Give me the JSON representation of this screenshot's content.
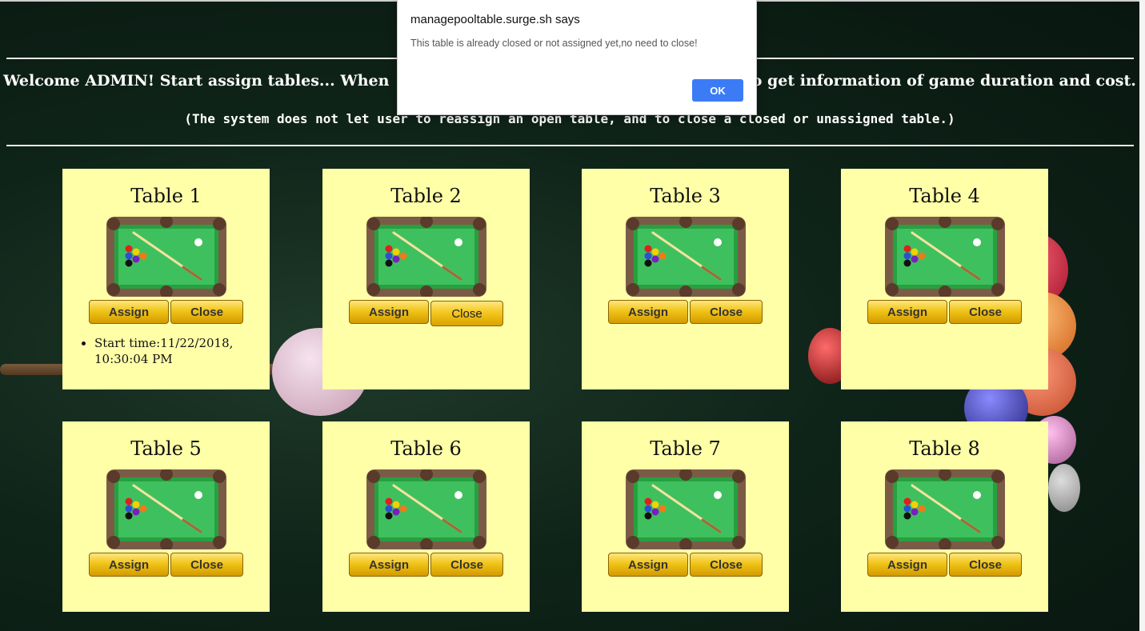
{
  "dialog": {
    "title": "managepooltable.surge.sh says",
    "message": "This table is already closed or not assigned yet,no need to close!",
    "ok_label": "OK",
    "button_color": "#3b7cf6"
  },
  "header": {
    "welcome": "Welcome ADMIN! Start assign tables... When",
    "welcome_tail": "o get information of game duration and cost.",
    "note": "(The system does not let user to reassign an open table, and to close a closed or unassigned table.)"
  },
  "colors": {
    "card_background": "#ffffa8",
    "button_gold": "#f0c418",
    "page_background": "#0f2419"
  },
  "tables": [
    {
      "title": "Table 1",
      "assign_label": "Assign",
      "close_label": "Close",
      "image_icon": "pool-table-icon",
      "start_time": "Start time:11/22/2018, 10:30:04 PM"
    },
    {
      "title": "Table 2",
      "assign_label": "Assign",
      "close_label": "Close",
      "image_icon": "pool-table-icon"
    },
    {
      "title": "Table 3",
      "assign_label": "Assign",
      "close_label": "Close",
      "image_icon": "pool-table-icon"
    },
    {
      "title": "Table 4",
      "assign_label": "Assign",
      "close_label": "Close",
      "image_icon": "pool-table-icon"
    },
    {
      "title": "Table 5",
      "assign_label": "Assign",
      "close_label": "Close",
      "image_icon": "pool-table-icon"
    },
    {
      "title": "Table 6",
      "assign_label": "Assign",
      "close_label": "Close",
      "image_icon": "pool-table-icon"
    },
    {
      "title": "Table 7",
      "assign_label": "Assign",
      "close_label": "Close",
      "image_icon": "pool-table-icon"
    },
    {
      "title": "Table 8",
      "assign_label": "Assign",
      "close_label": "Close",
      "image_icon": "pool-table-icon"
    }
  ]
}
